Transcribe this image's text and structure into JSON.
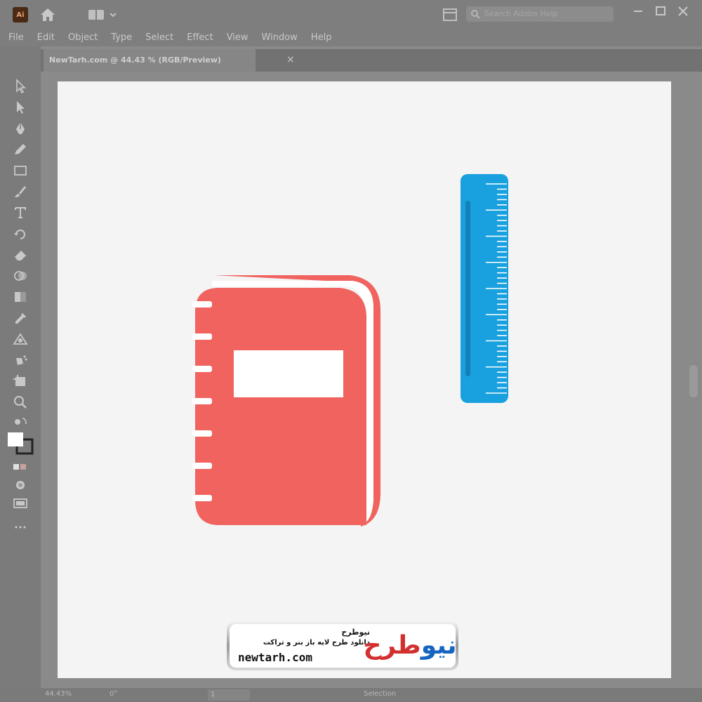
{
  "app": {
    "logo_text": "Ai"
  },
  "titlebar": {
    "search_placeholder": "Search Adobe Help"
  },
  "menu": [
    "File",
    "Edit",
    "Object",
    "Type",
    "Select",
    "Effect",
    "View",
    "Window",
    "Help"
  ],
  "document_tab": {
    "title": "NewTarh.com @ 44.43 % (RGB/Preview)",
    "close": "×"
  },
  "icons": {
    "toolbar": [
      "selection-arrow-icon",
      "direct-selection-icon",
      "pen-icon",
      "pencil-icon",
      "rectangle-icon",
      "brush-icon",
      "type-icon",
      "rotate-icon",
      "eraser-icon",
      "shape-builder-icon",
      "gradient-icon",
      "eyedropper-icon",
      "blend-icon",
      "symbol-sprayer-icon",
      "artboard-icon",
      "zoom-icon"
    ]
  },
  "artwork": {
    "notebook": {
      "cover_color": "#f0635f",
      "label_color": "#ffffff",
      "ring_count": 7
    },
    "ruler": {
      "color": "#18a0df",
      "tick_color": "#ffffff"
    }
  },
  "watermark": {
    "brand_fa": "نیوطرح",
    "tagline_fa": "دانلود طرح لایه باز بنر و تراکت",
    "url": "newtarh.com",
    "logo_main": "نیو",
    "logo_accent": "طرح"
  },
  "statusbar": {
    "zoom": "44.43%",
    "rotate": "0°",
    "artboard": "1",
    "tool": "Selection"
  }
}
